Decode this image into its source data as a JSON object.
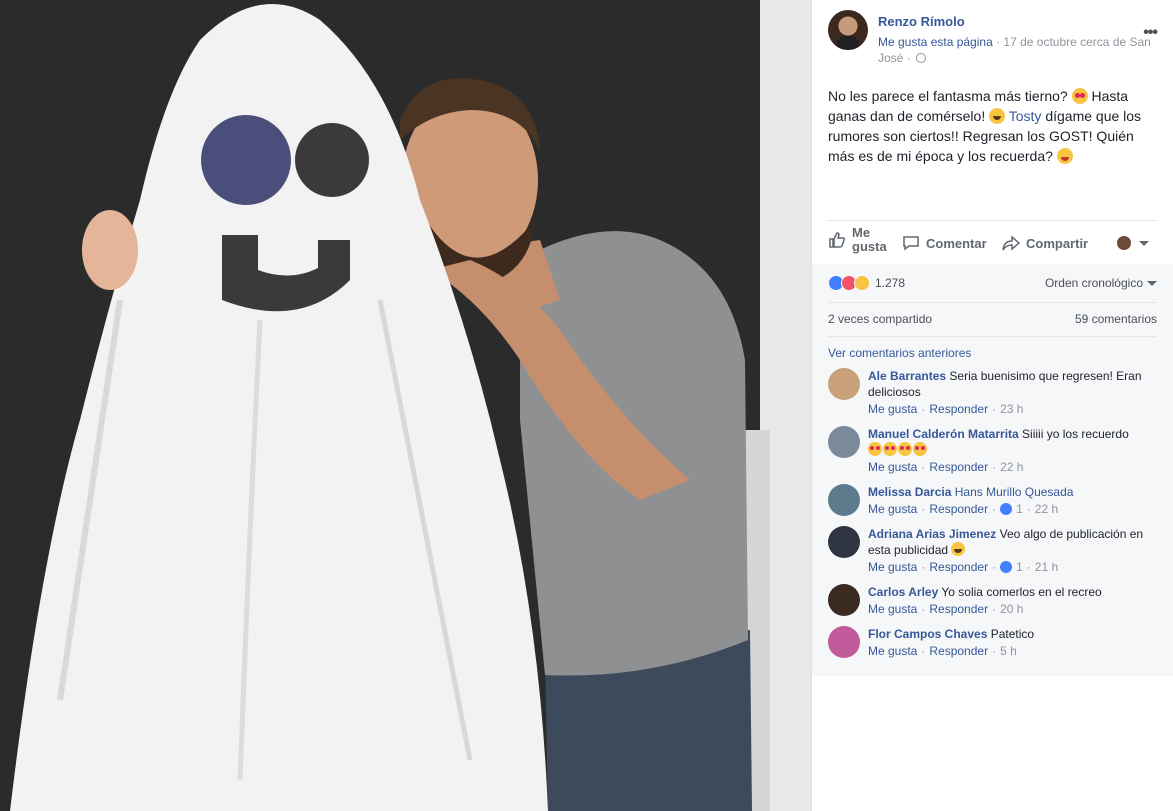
{
  "post": {
    "author": "Renzo Rímolo",
    "like_page": "Me gusta esta página",
    "meta_rest": " · 17 de octubre cerca de San José · ",
    "more": "•••",
    "text_1": "No les parece el fantasma más tierno? ",
    "text_2": " Hasta ganas dan de comérselo! ",
    "mention": "Tosty",
    "text_3": " dígame que los rumores son ciertos!! Regresan los GOST! Quién más es de mi época y los recuerda? "
  },
  "actions": {
    "like": "Me gusta",
    "comment": "Comentar",
    "share": "Compartir"
  },
  "reactions": {
    "count": "1.278",
    "sort_label": "Orden cronológico"
  },
  "shares": {
    "shared": "2 veces compartido",
    "comments": "59 comentarios"
  },
  "previous_comments": "Ver comentarios anteriores",
  "comment_actions": {
    "like": "Me gusta",
    "reply": "Responder"
  },
  "comments": [
    {
      "name": "Ale Barrantes",
      "text": "Seria buenisimo que regresen! Eran deliciosos",
      "likes": "",
      "time": "23 h",
      "avatar_color": "#c9a27a"
    },
    {
      "name": "Manuel Calderón Matarrita",
      "text": "Siiiii yo los recuerdo",
      "likes": "",
      "time": "22 h",
      "avatar_color": "#7a8a9a"
    },
    {
      "name": "Melissa Darcia",
      "text": "Hans Murillo Quesada",
      "likes": "1",
      "time": "22 h",
      "avatar_color": "#5c7a8c"
    },
    {
      "name": "Adriana Arias Jimenez",
      "text": "Veo algo de publicación en esta publicidad ",
      "likes": "1",
      "time": "21 h",
      "avatar_color": "#2e3440"
    },
    {
      "name": "Carlos Arley",
      "text": "Yo solia comerlos en el recreo",
      "likes": "",
      "time": "20 h",
      "avatar_color": "#3a2a22"
    },
    {
      "name": "Flor Campos Chaves",
      "text": "Patetico",
      "likes": "",
      "time": "5 h",
      "avatar_color": "#c05a9a"
    }
  ]
}
